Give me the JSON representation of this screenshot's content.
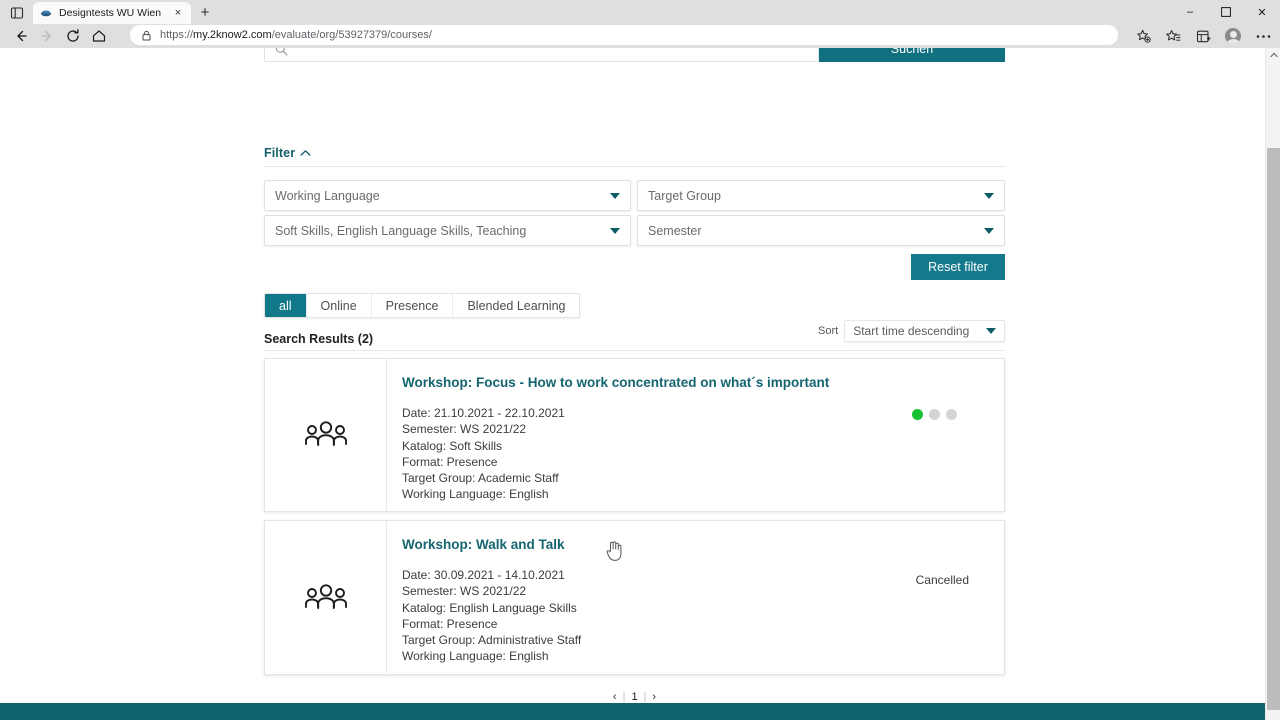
{
  "browser": {
    "tab_title": "Designtests WU Wien",
    "tab_close_label": "×",
    "new_tab_label": "+",
    "window_minimize": "–",
    "window_maximize": "❐",
    "window_close": "✕",
    "url_scheme": "https://",
    "url_host": "my.2know2.com",
    "url_path": "/evaluate/org/53927379/courses/",
    "icons": {
      "sidebar": "tab-sidebar-icon",
      "back": "back-arrow-icon",
      "forward": "forward-arrow-icon",
      "reload": "reload-icon",
      "home": "home-icon",
      "lock": "lock-icon",
      "favorite_add": "add-favorite-icon",
      "favorites": "favorites-icon",
      "collections": "collections-icon",
      "profile": "profile-avatar-icon",
      "settings_more": "more-options-icon"
    }
  },
  "search": {
    "placeholder": "",
    "value": "",
    "button_label": "Suchen",
    "icon": "search-icon"
  },
  "filter": {
    "title": "Filter",
    "chevron": "chevron-up-icon",
    "selects": [
      {
        "name": "working-language",
        "value": "Working Language"
      },
      {
        "name": "target-group",
        "value": "Target Group"
      },
      {
        "name": "katalog",
        "value": "Soft Skills, English Language Skills, Teaching"
      },
      {
        "name": "semester",
        "value": "Semester"
      }
    ],
    "reset_label": "Reset filter"
  },
  "tabs": [
    {
      "label": "all",
      "active": true
    },
    {
      "label": "Online",
      "active": false
    },
    {
      "label": "Presence",
      "active": false
    },
    {
      "label": "Blended Learning",
      "active": false
    }
  ],
  "results": {
    "heading": "Search Results (2)",
    "sort_label": "Sort",
    "sort_value": "Start time descending",
    "cards": [
      {
        "title": "Workshop: Focus - How to work concentrated on what´s important",
        "thumb_icon": "group-people-icon",
        "meta": [
          "Date: 21.10.2021 - 22.10.2021",
          "Semester: WS 2021/22",
          "Katalog: Soft Skills",
          "Format: Presence",
          "Target Group: Academic Staff",
          "Working Language: English"
        ],
        "status_type": "dots",
        "dots": [
          "green",
          "grey",
          "grey"
        ],
        "status_text": ""
      },
      {
        "title": "Workshop: Walk and Talk",
        "thumb_icon": "group-people-icon",
        "meta": [
          "Date: 30.09.2021 - 14.10.2021",
          "Semester: WS 2021/22",
          "Katalog: English Language Skills",
          "Format: Presence",
          "Target Group: Administrative Staff",
          "Working Language: English"
        ],
        "status_type": "text",
        "dots": [],
        "status_text": "Cancelled"
      }
    ]
  },
  "pagination": {
    "prev": "‹",
    "sep_left": "|",
    "page": "1",
    "sep_right": "|",
    "next": "›"
  },
  "colors": {
    "teal_primary": "#11788a",
    "teal_dark": "#10626e",
    "teal_title": "#156570",
    "green_status": "#17c132",
    "grey_status": "#d4d4d4"
  }
}
